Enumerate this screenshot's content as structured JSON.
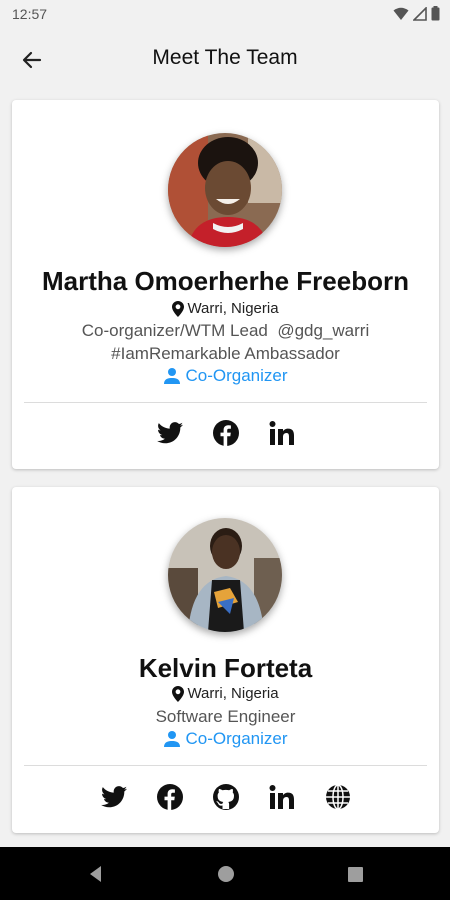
{
  "status_bar": {
    "time": "12:57"
  },
  "app_bar": {
    "title": "Meet The Team",
    "back_icon": "arrow-left-icon"
  },
  "members": [
    {
      "name": "Martha Omoerherhe Freeborn",
      "location": "Warri, Nigeria",
      "bio_lines": [
        "Co-organizer/WTM Lead  @gdg_warri",
        "#IamRemarkable Ambassador"
      ],
      "role": "Co-Organizer",
      "socials": [
        "twitter-icon",
        "facebook-icon",
        "linkedin-icon"
      ]
    },
    {
      "name": "Kelvin Forteta",
      "location": "Warri, Nigeria",
      "bio_lines": [
        "Software Engineer"
      ],
      "role": "Co-Organizer",
      "socials": [
        "twitter-icon",
        "facebook-icon",
        "github-icon",
        "linkedin-icon",
        "globe-icon"
      ]
    }
  ],
  "colors": {
    "accent": "#2196f3",
    "background": "#f1f1f1",
    "card": "#ffffff",
    "nav_bar": "#000000"
  }
}
